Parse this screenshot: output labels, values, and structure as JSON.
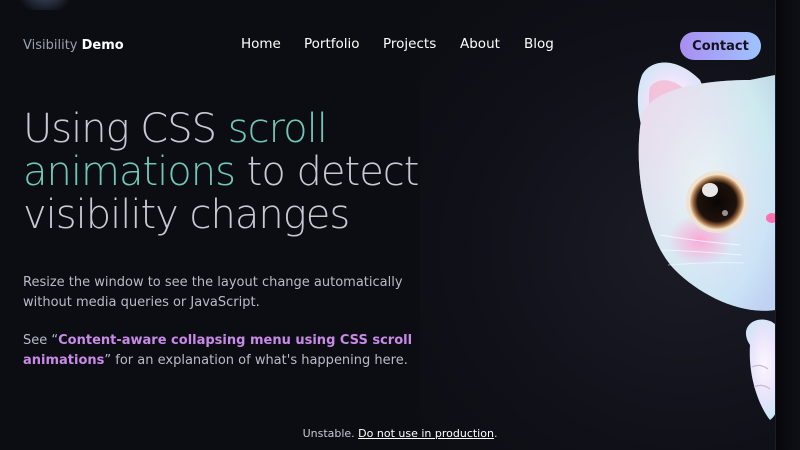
{
  "brand": {
    "prefix": "Visibility",
    "name": "Demo"
  },
  "nav": {
    "items": [
      {
        "label": "Home"
      },
      {
        "label": "Portfolio"
      },
      {
        "label": "Projects"
      },
      {
        "label": "About"
      },
      {
        "label": "Blog"
      }
    ],
    "contact_label": "Contact"
  },
  "hero": {
    "line1_plain": "Using CSS ",
    "line1_accent": "scroll",
    "line2_accent": "animations",
    "line2_plain": " to detect",
    "line3_plain": "visibility changes"
  },
  "body": {
    "paragraph1": "Resize the window to see the layout change automatically without media queries or JavaScript.",
    "p2_prefix": "See “",
    "p2_link": "Content-aware collapsing menu using CSS scroll animations",
    "p2_suffix": "” for an explanation of what's happening here."
  },
  "footer": {
    "prefix": "Unstable. ",
    "link": "Do not use in production",
    "suffix": "."
  },
  "colors": {
    "background": "#0c0d12",
    "accent_teal": "#6ec8b8",
    "accent_purple": "#c989e8",
    "contact_gradient_start": "#a98ef0",
    "contact_gradient_end": "#9ec3ff"
  }
}
